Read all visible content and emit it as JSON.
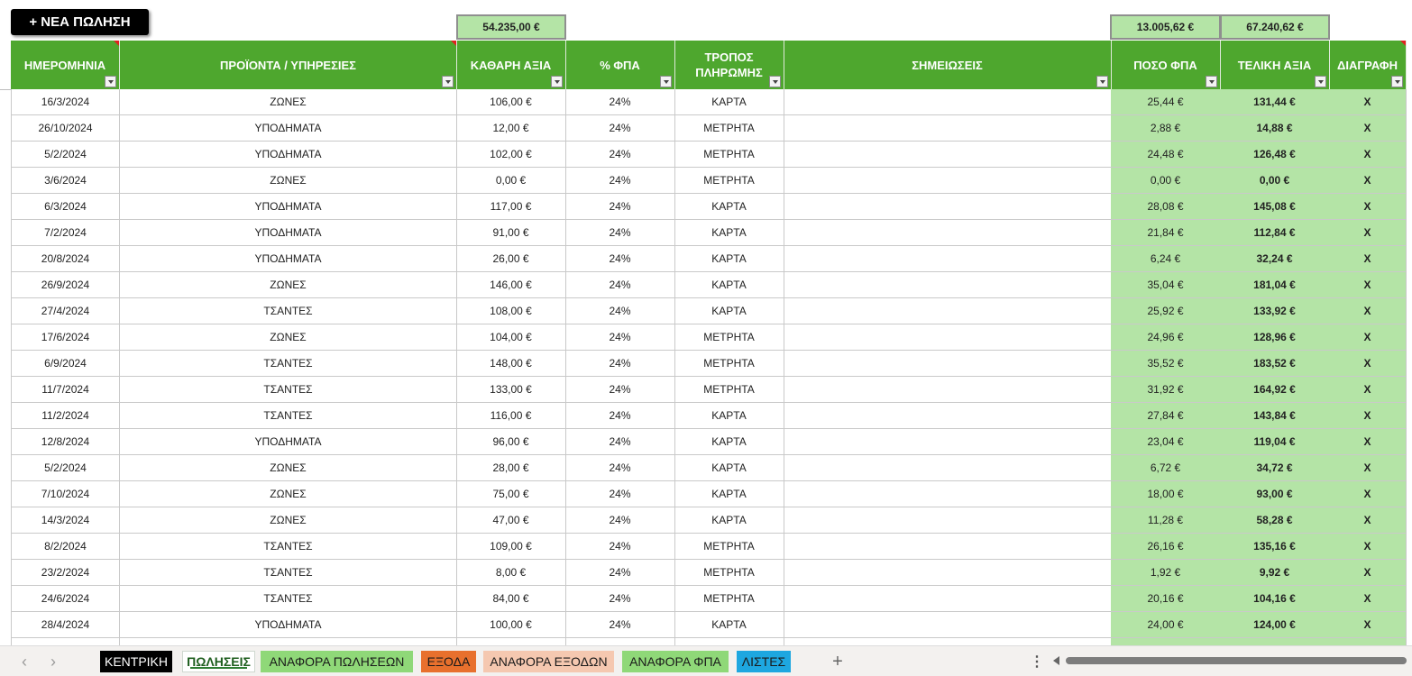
{
  "toolbar": {
    "new_sale_label": "+ ΝΕΑ ΠΩΛΗΣΗ"
  },
  "totals": {
    "net_value": "54.235,00 €",
    "vat_amount": "13.005,62 €",
    "final_value": "67.240,62 €"
  },
  "columns": [
    "ΗΜΕΡΟΜΗΝΙΑ",
    "ΠΡΟΪΟΝΤΑ / ΥΠΗΡΕΣΙΕΣ",
    "ΚΑΘΑΡΗ ΑΞΙΑ",
    "% ΦΠΑ",
    "ΤΡΟΠΟΣ ΠΛΗΡΩΜΗΣ",
    "ΣΗΜΕΙΩΣΕΙΣ",
    "ΠΟΣΟ ΦΠΑ",
    "ΤΕΛΙΚΗ ΑΞΙΑ",
    "ΔΙΑΓΡΑΦΗ"
  ],
  "rows": [
    [
      "16/3/2024",
      "ΖΩΝΕΣ",
      "106,00 €",
      "24%",
      "ΚΑΡΤΑ",
      "",
      "25,44 €",
      "131,44 €",
      "X"
    ],
    [
      "26/10/2024",
      "ΥΠΟΔΗΜΑΤΑ",
      "12,00 €",
      "24%",
      "ΜΕΤΡΗΤΑ",
      "",
      "2,88 €",
      "14,88 €",
      "X"
    ],
    [
      "5/2/2024",
      "ΥΠΟΔΗΜΑΤΑ",
      "102,00 €",
      "24%",
      "ΜΕΤΡΗΤΑ",
      "",
      "24,48 €",
      "126,48 €",
      "X"
    ],
    [
      "3/6/2024",
      "ΖΩΝΕΣ",
      "0,00 €",
      "24%",
      "ΜΕΤΡΗΤΑ",
      "",
      "0,00 €",
      "0,00 €",
      "X"
    ],
    [
      "6/3/2024",
      "ΥΠΟΔΗΜΑΤΑ",
      "117,00 €",
      "24%",
      "ΚΑΡΤΑ",
      "",
      "28,08 €",
      "145,08 €",
      "X"
    ],
    [
      "7/2/2024",
      "ΥΠΟΔΗΜΑΤΑ",
      "91,00 €",
      "24%",
      "ΚΑΡΤΑ",
      "",
      "21,84 €",
      "112,84 €",
      "X"
    ],
    [
      "20/8/2024",
      "ΥΠΟΔΗΜΑΤΑ",
      "26,00 €",
      "24%",
      "ΚΑΡΤΑ",
      "",
      "6,24 €",
      "32,24 €",
      "X"
    ],
    [
      "26/9/2024",
      "ΖΩΝΕΣ",
      "146,00 €",
      "24%",
      "ΚΑΡΤΑ",
      "",
      "35,04 €",
      "181,04 €",
      "X"
    ],
    [
      "27/4/2024",
      "ΤΣΑΝΤΕΣ",
      "108,00 €",
      "24%",
      "ΚΑΡΤΑ",
      "",
      "25,92 €",
      "133,92 €",
      "X"
    ],
    [
      "17/6/2024",
      "ΖΩΝΕΣ",
      "104,00 €",
      "24%",
      "ΜΕΤΡΗΤΑ",
      "",
      "24,96 €",
      "128,96 €",
      "X"
    ],
    [
      "6/9/2024",
      "ΤΣΑΝΤΕΣ",
      "148,00 €",
      "24%",
      "ΜΕΤΡΗΤΑ",
      "",
      "35,52 €",
      "183,52 €",
      "X"
    ],
    [
      "11/7/2024",
      "ΤΣΑΝΤΕΣ",
      "133,00 €",
      "24%",
      "ΜΕΤΡΗΤΑ",
      "",
      "31,92 €",
      "164,92 €",
      "X"
    ],
    [
      "11/2/2024",
      "ΤΣΑΝΤΕΣ",
      "116,00 €",
      "24%",
      "ΚΑΡΤΑ",
      "",
      "27,84 €",
      "143,84 €",
      "X"
    ],
    [
      "12/8/2024",
      "ΥΠΟΔΗΜΑΤΑ",
      "96,00 €",
      "24%",
      "ΚΑΡΤΑ",
      "",
      "23,04 €",
      "119,04 €",
      "X"
    ],
    [
      "5/2/2024",
      "ΖΩΝΕΣ",
      "28,00 €",
      "24%",
      "ΚΑΡΤΑ",
      "",
      "6,72 €",
      "34,72 €",
      "X"
    ],
    [
      "7/10/2024",
      "ΖΩΝΕΣ",
      "75,00 €",
      "24%",
      "ΚΑΡΤΑ",
      "",
      "18,00 €",
      "93,00 €",
      "X"
    ],
    [
      "14/3/2024",
      "ΖΩΝΕΣ",
      "47,00 €",
      "24%",
      "ΚΑΡΤΑ",
      "",
      "11,28 €",
      "58,28 €",
      "X"
    ],
    [
      "8/2/2024",
      "ΤΣΑΝΤΕΣ",
      "109,00 €",
      "24%",
      "ΜΕΤΡΗΤΑ",
      "",
      "26,16 €",
      "135,16 €",
      "X"
    ],
    [
      "23/2/2024",
      "ΤΣΑΝΤΕΣ",
      "8,00 €",
      "24%",
      "ΜΕΤΡΗΤΑ",
      "",
      "1,92 €",
      "9,92 €",
      "X"
    ],
    [
      "24/6/2024",
      "ΤΣΑΝΤΕΣ",
      "84,00 €",
      "24%",
      "ΜΕΤΡΗΤΑ",
      "",
      "20,16 €",
      "104,16 €",
      "X"
    ],
    [
      "28/4/2024",
      "ΥΠΟΔΗΜΑΤΑ",
      "100,00 €",
      "24%",
      "ΚΑΡΤΑ",
      "",
      "24,00 €",
      "124,00 €",
      "X"
    ],
    [
      "",
      "",
      "",
      "",
      "",
      "",
      "",
      "",
      ""
    ]
  ],
  "sheet_tabs": [
    {
      "label": "ΚΕΝΤΡΙΚΗ",
      "bg": "#000000",
      "fg": "#ffffff",
      "active": false
    },
    {
      "label": "ΠΩΛΗΣΕΙΣ",
      "bg": "#ffffff",
      "fg": "#1e5e1e",
      "active": true
    },
    {
      "label": "ΑΝΑΦΟΡΑ ΠΩΛΗΣΕΩΝ",
      "bg": "#8fd878",
      "fg": "#1a1a1a",
      "active": false
    },
    {
      "label": "ΕΞΟΔΑ",
      "bg": "#e8702d",
      "fg": "#1a1a1a",
      "active": false
    },
    {
      "label": "ΑΝΑΦΟΡΑ ΕΞΟΔΩΝ",
      "bg": "#f5c8b0",
      "fg": "#1a1a1a",
      "active": false
    },
    {
      "label": "ΑΝΑΦΟΡΑ ΦΠΑ",
      "bg": "#8fd878",
      "fg": "#1a1a1a",
      "active": false
    },
    {
      "label": "ΛΙΣΤΕΣ",
      "bg": "#1ea7e0",
      "fg": "#1a1a1a",
      "active": false
    }
  ],
  "icons": {
    "prev_sheet": "chevron-left-icon",
    "next_sheet": "chevron-right-icon",
    "add_sheet": "plus-icon",
    "more": "more-dots-icon",
    "filter": "dropdown-filter-icon"
  },
  "colors": {
    "header_green": "#4ea72e",
    "total_green": "#b4e4a6",
    "grid": "#c9c9c9"
  }
}
